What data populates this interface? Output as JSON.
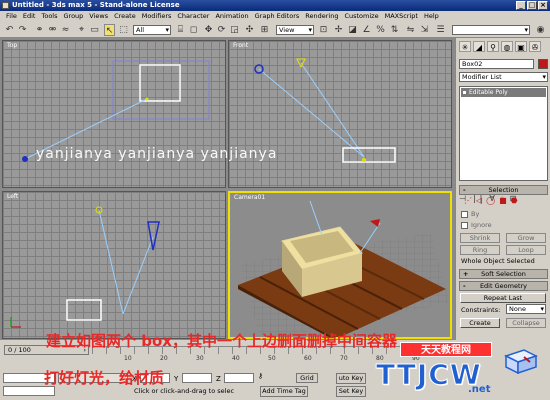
{
  "window": {
    "title": "Untitled - 3ds max 5 - Stand-alone License",
    "controls": [
      "_",
      "□",
      "×"
    ]
  },
  "menu": [
    "File",
    "Edit",
    "Tools",
    "Group",
    "Views",
    "Create",
    "Modifiers",
    "Character",
    "Animation",
    "Graph Editors",
    "Rendering",
    "Customize",
    "MAXScript",
    "Help"
  ],
  "toolbar": {
    "selection_filter": "All",
    "coord_system": "View"
  },
  "viewports": {
    "top": "Top",
    "front": "Front",
    "left": "Left",
    "camera": "Camera01"
  },
  "watermark": "yanjianya yanjianya yanjianya",
  "command_panel": {
    "object_name": "Box02",
    "object_color": "#c01818",
    "modifier_list": "Modifier List",
    "stack_item": "Editable Poly",
    "selection_rollout": "Selection",
    "by_vertex": "By",
    "ignore_backfacing": "Ignore",
    "shrink": "Shrink",
    "grow": "Grow",
    "ring": "Ring",
    "loop": "Loop",
    "selection_status": "Whole Object Selected",
    "soft_selection_rollout": "Soft Selection",
    "edit_geometry_rollout": "Edit Geometry",
    "repeat_last": "Repeat Last",
    "constraints_label": "Constraints:",
    "constraints_value": "None",
    "create": "Create",
    "collapse": "Collapse"
  },
  "timeline": {
    "frame_display": "0 / 100",
    "tick_labels": [
      "10",
      "20",
      "30",
      "40",
      "50",
      "60",
      "70",
      "80",
      "90"
    ]
  },
  "status": {
    "coord_label_x": "X",
    "coord_label_y": "Y",
    "coord_label_z": "Z",
    "grid": "Grid",
    "auto_key": "uto Key",
    "set_key": "Set Key",
    "prompt": "Click or click-and-drag to selec",
    "add_time_tag": "Add Time Tag"
  },
  "captions": {
    "line1": "建立如图两个 box，其中一个上边删面删掉中间容器",
    "line2": "打好灯光，给材质"
  },
  "logo": {
    "top": "天天教程网",
    "main": "TTJCW",
    "sub": ".net"
  }
}
